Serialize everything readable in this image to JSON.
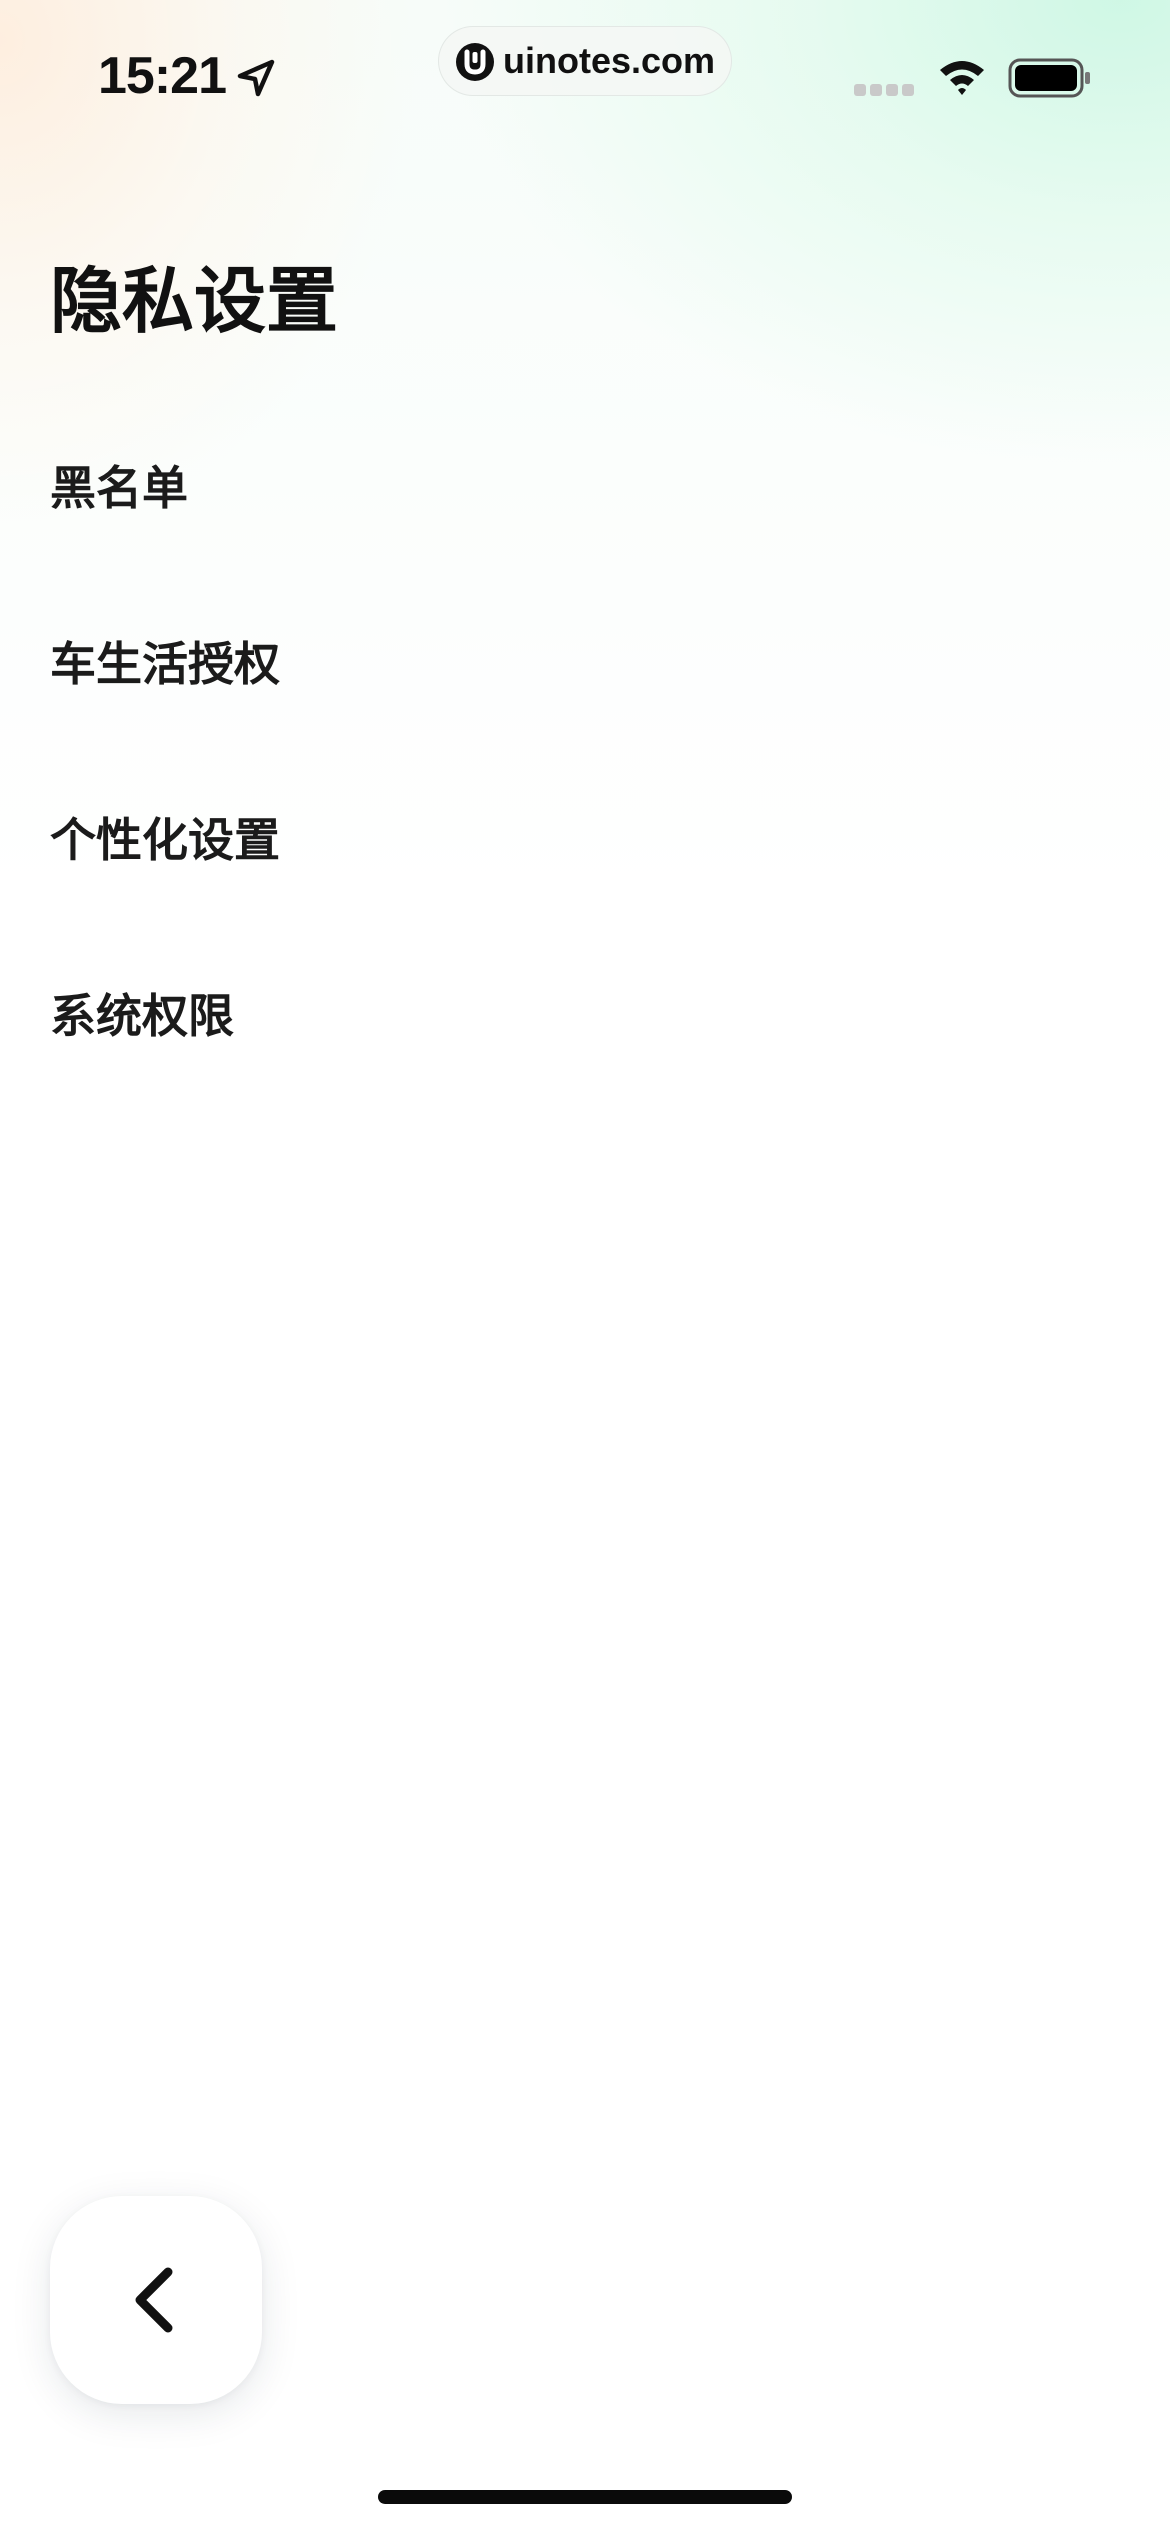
{
  "status_bar": {
    "time": "15:21",
    "url": "uinotes.com",
    "icons": [
      "location-arrow-icon",
      "uinotes-logo-icon",
      "cellular-signal-icon",
      "wifi-icon",
      "battery-icon"
    ]
  },
  "page": {
    "title": "隐私设置"
  },
  "settings_list": {
    "items": [
      {
        "label": "黑名单"
      },
      {
        "label": "车生活授权"
      },
      {
        "label": "个性化设置"
      },
      {
        "label": "系统权限"
      }
    ]
  },
  "navigation": {
    "back_icon": "chevron-left-icon"
  },
  "colors": {
    "text": "#161616",
    "background": "#ffffff",
    "gradient_mint": "#cdf7e4",
    "gradient_peach": "#ffecdb"
  }
}
